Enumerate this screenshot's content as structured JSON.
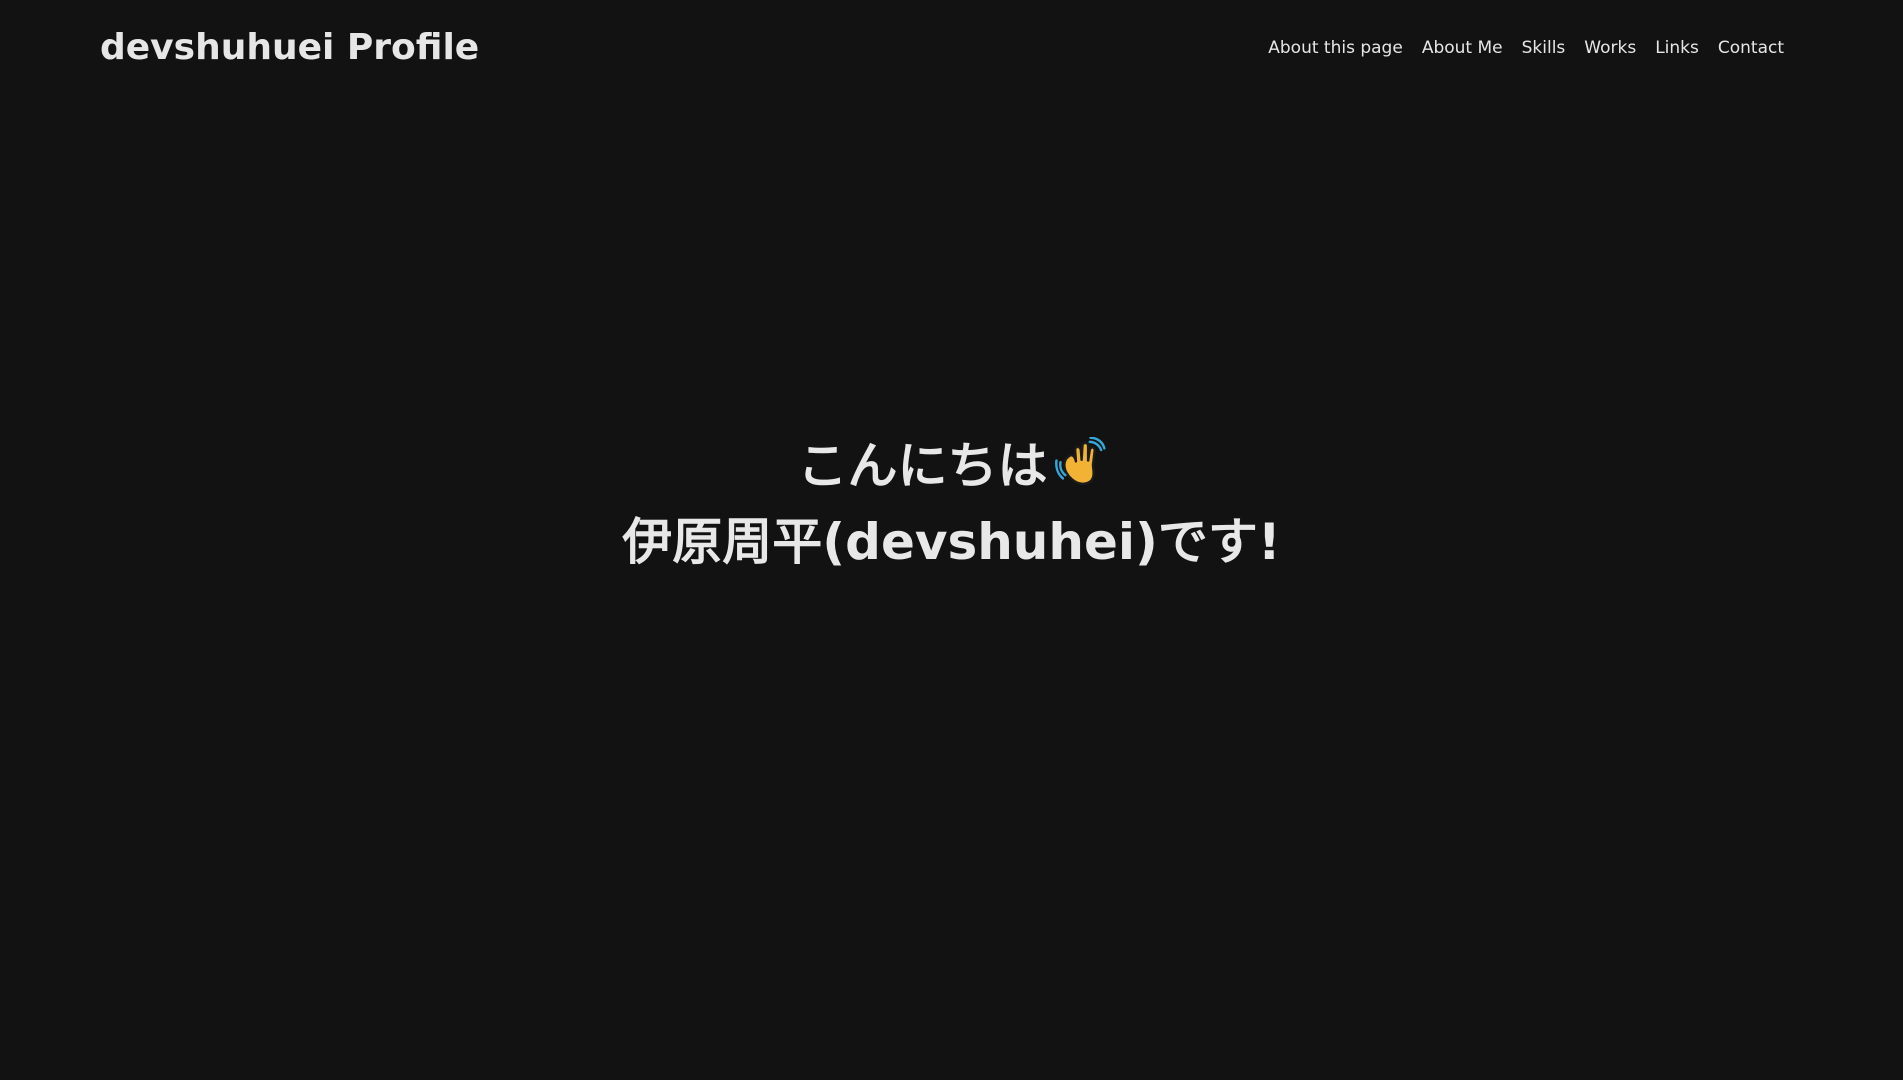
{
  "header": {
    "site_title": "devshuhuei Profile",
    "nav": [
      {
        "label": "About this page"
      },
      {
        "label": "About Me"
      },
      {
        "label": "Skills"
      },
      {
        "label": "Works"
      },
      {
        "label": "Links"
      },
      {
        "label": "Contact"
      }
    ]
  },
  "hero": {
    "greeting": "こんにちは",
    "greeting_icon": "waving-hand-icon",
    "intro": "伊原周平(devshuhei)です!"
  },
  "colors": {
    "background": "#121212",
    "text": "#e8e8e8",
    "wave_hand": "#f2b233",
    "wave_lines": "#35a8d8"
  }
}
